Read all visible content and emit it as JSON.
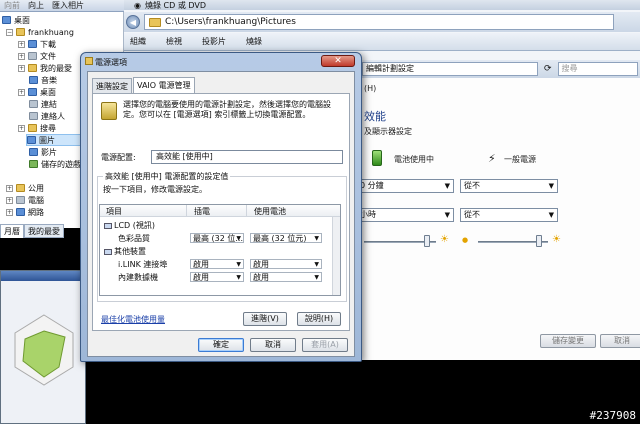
{
  "explorer": {
    "toolbar": {
      "back": "向前",
      "up": "向上",
      "import": "匯入相片"
    },
    "burn_label": "燒錄 CD 或 DVD",
    "address": "C:\\Users\\frankhuang\\Pictures",
    "cmdbar": {
      "organize": "組織",
      "item2": "檢視",
      "item3": "投影片",
      "item4": "燒錄"
    },
    "tree": [
      {
        "label": "桌面",
        "icon": "desktop-icon"
      },
      {
        "label": "frankhuang",
        "icon": "user-folder-icon"
      },
      {
        "label": "下載",
        "icon": "folder-icon"
      },
      {
        "label": "文件",
        "icon": "folder-icon"
      },
      {
        "label": "我的最愛",
        "icon": "folder-icon"
      },
      {
        "label": "音樂",
        "icon": "folder-icon"
      },
      {
        "label": "桌面",
        "icon": "folder-icon"
      },
      {
        "label": "連結",
        "icon": "folder-icon"
      },
      {
        "label": "連絡人",
        "icon": "folder-icon"
      },
      {
        "label": "搜尋",
        "icon": "folder-icon"
      },
      {
        "label": "圖片",
        "icon": "folder-icon"
      },
      {
        "label": "影片",
        "icon": "folder-icon"
      },
      {
        "label": "儲存的遊戲",
        "icon": "folder-icon"
      },
      {
        "label": "公用",
        "icon": "folder-icon"
      },
      {
        "label": "電腦",
        "icon": "computer-icon"
      },
      {
        "label": "網路",
        "icon": "network-icon"
      }
    ],
    "tabs": [
      "月曆",
      "我的最愛"
    ]
  },
  "control_panel": {
    "address": "編輯計劃設定",
    "search_placeholder": "搜尋",
    "heading": "效能",
    "subtext": "及顯示器設定",
    "col_battery": "電池使用中",
    "col_plugged": "一般電源",
    "dim_battery": "0 分鐘",
    "dim_plugged": "從不",
    "sleep_battery": "小時",
    "sleep_plugged": "從不",
    "save_button": "儲存變更",
    "cancel_button": "取消",
    "menu_hint": "(H)"
  },
  "dialog": {
    "title": "電源選項",
    "tabs": [
      "進階設定",
      "VAIO 電源管理"
    ],
    "description": "選擇您的電腦要使用的電源計劃設定，然後選擇您的電腦設定。您可以在 [電源選項] 索引標籤上切換電源配置。",
    "plan_label": "電源配置:",
    "plan_value": "高效能 [使用中]",
    "group_title": "高效能 [使用中] 電源配置的設定值",
    "group_hint": "按一下項目，修改電源設定。",
    "table": {
      "headers": [
        "項目",
        "插電",
        "使用電池"
      ],
      "rows": [
        {
          "type": "group",
          "label": "LCD (視訊)"
        },
        {
          "type": "item",
          "label": "色彩品質",
          "ac": "最高 (32 位...",
          "dc": "最高 (32 位元)"
        },
        {
          "type": "group",
          "label": "其他裝置"
        },
        {
          "type": "item",
          "label": "i.LINK 連接埠",
          "ac": "啟用",
          "dc": "啟用"
        },
        {
          "type": "item",
          "label": "內建數據機",
          "ac": "啟用",
          "dc": "啟用"
        }
      ]
    },
    "link": "最佳化電池使用量",
    "advanced_button": "進階(V)",
    "help_button": "說明(H)",
    "ok_button": "確定",
    "cancel_button": "取消",
    "apply_button": "套用(A)"
  },
  "watermark": "#237908",
  "colors": {
    "accent": "#1a3fa8",
    "title_bar": "#b7cbe6",
    "close": "#c0392b"
  }
}
